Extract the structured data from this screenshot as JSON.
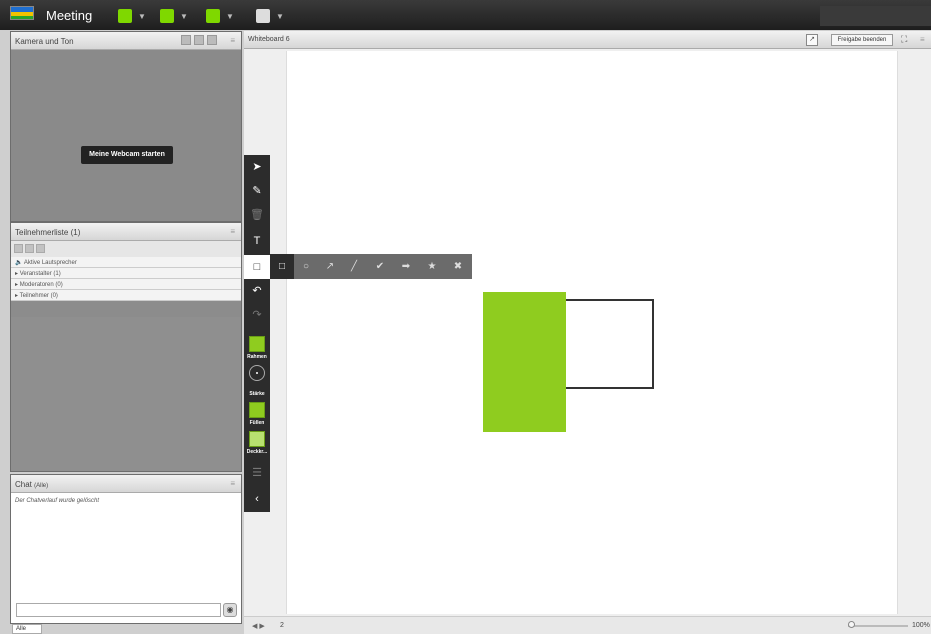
{
  "app": {
    "title": "Meeting"
  },
  "panes": {
    "camera": {
      "title": "Kamera und Ton",
      "start_button": "Meine Webcam starten"
    },
    "participants": {
      "title": "Teilnehmerliste",
      "count": "(1)",
      "active_speakers": "Aktive Lautsprecher",
      "groups": [
        "Veranstalter (1)",
        "Moderatoren (0)",
        "Teilnehmer (0)"
      ]
    },
    "chat": {
      "title": "Chat",
      "scope": "(Alle)",
      "message": "Der Chatverlauf wurde gelöscht",
      "tab": "Alle",
      "send_icon": "send-icon"
    }
  },
  "whiteboard": {
    "title": "Whiteboard 6",
    "stop_share": "Freigabe beenden",
    "page": "2",
    "zoom": "100%"
  },
  "toolbar": {
    "text_tool": "T",
    "labels": {
      "frame": "Rahmen",
      "stroke": "Stärke",
      "fill": "Füllen",
      "opacity": "Deckkr..."
    },
    "fill_color": "#8fcc1f",
    "collapse": "‹"
  },
  "shapes": {
    "fill_color": "#8fcc1f",
    "stroke_color": "#333333"
  }
}
